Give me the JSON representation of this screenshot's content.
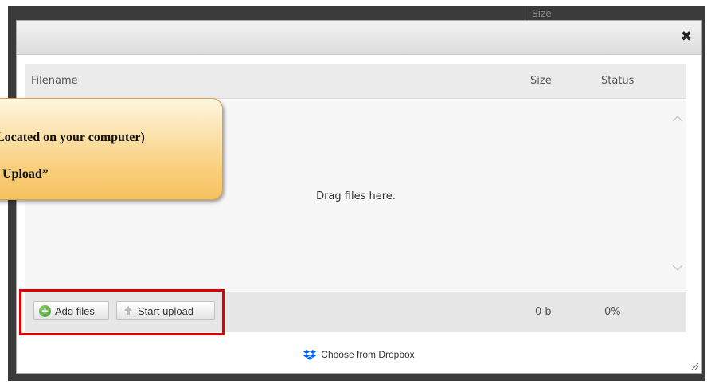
{
  "background": {
    "column_header": "Size"
  },
  "dialog": {
    "close_glyph": "✖"
  },
  "table": {
    "headers": {
      "filename": "Filename",
      "size": "Size",
      "status": "Status"
    },
    "empty_text": "Drag files here."
  },
  "toolbar": {
    "add_files_label": "Add files",
    "start_upload_label": "Start upload",
    "total_size": "0 b",
    "total_status": "0%"
  },
  "dropbox": {
    "label": "Choose from Dropbox"
  },
  "callout": {
    "line1": "Located on your computer)",
    "line2": "Upload”"
  },
  "colors": {
    "highlight": "#e00000",
    "callout_fill": "#f9cf7c",
    "dropbox_blue": "#0061ff",
    "add_icon_green": "#3c9a2a"
  },
  "icons": [
    "close-icon",
    "plus-circle-icon",
    "upload-arrow-icon",
    "dropbox-icon",
    "resize-grip-icon",
    "scroll-up-icon",
    "scroll-down-icon"
  ]
}
